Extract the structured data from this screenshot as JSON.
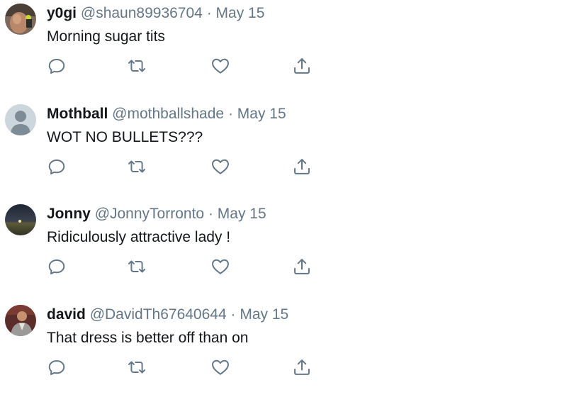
{
  "icons": {
    "reply": "reply-icon",
    "retweet": "retweet-icon",
    "like": "heart-icon",
    "share": "share-icon"
  },
  "colors": {
    "icon": "#657786",
    "muted_text": "#657786",
    "text": "#14171a"
  },
  "tweets": [
    {
      "name": "y0gi",
      "handle": "@shaun89936704",
      "separator": "·",
      "date": "May 15",
      "text": "Morning sugar tits"
    },
    {
      "name": "Mothball",
      "handle": "@mothballshade",
      "separator": "·",
      "date": "May 15",
      "text": "WOT NO BULLETS???"
    },
    {
      "name": "Jonny",
      "handle": "@JonnyTorronto",
      "separator": "·",
      "date": "May 15",
      "text": "Ridiculously attractive lady !"
    },
    {
      "name": "david",
      "handle": "@DavidTh67640644",
      "separator": "·",
      "date": "May 15",
      "text": "That dress is better off than on"
    }
  ]
}
